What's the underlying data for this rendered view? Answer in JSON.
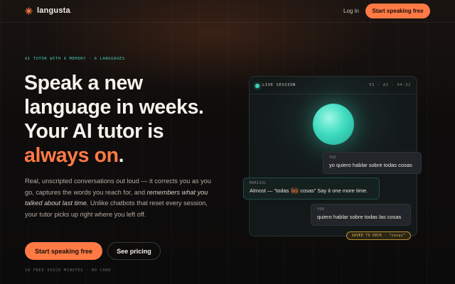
{
  "brand": {
    "name": "langusta",
    "dot": ".",
    "accent_color": "#ff7a45",
    "secondary_color": "#3fd2b8"
  },
  "nav": {
    "login_label": "Log in",
    "cta_label": "Start speaking free"
  },
  "hero": {
    "eyebrow": "AI TUTOR WITH A MEMORY · 6 LANGUAGES",
    "headline": {
      "line1": "Speak a new",
      "line2": "language in weeks.",
      "line3": "Your AI tutor is",
      "accent": "always on",
      "end": "."
    },
    "body": {
      "part1": "Real, unscripted conversations out loud — it corrects you as you go, captures the words you reach for, and ",
      "emphasis": "remembers what you talked about last time.",
      "part2": " Unlike chatbots that reset every session, your tutor picks up right where you left off."
    },
    "primary_cta": "Start speaking free",
    "secondary_cta": "See pricing",
    "fine_print": "10 FREE VOICE MINUTES · NO CARD"
  },
  "session": {
    "status_label": "LIVE SESSION",
    "meta": "ES · A2 · 04:32",
    "icons": {
      "status": "live-dot-icon",
      "orb": "voice-orb"
    },
    "messages": [
      {
        "speaker": "YOU",
        "text": "yo quiero hablar sobre todas cosas"
      },
      {
        "speaker": "MARISOL",
        "before": "Almost — “todas ",
        "highlight": "las",
        "after": " cosas” Say it one more time."
      },
      {
        "speaker": "YOU",
        "text": "quiero hablar sobre todas las cosas"
      }
    ],
    "saved_badge": "SAVED TO DECK · “cosas”"
  }
}
